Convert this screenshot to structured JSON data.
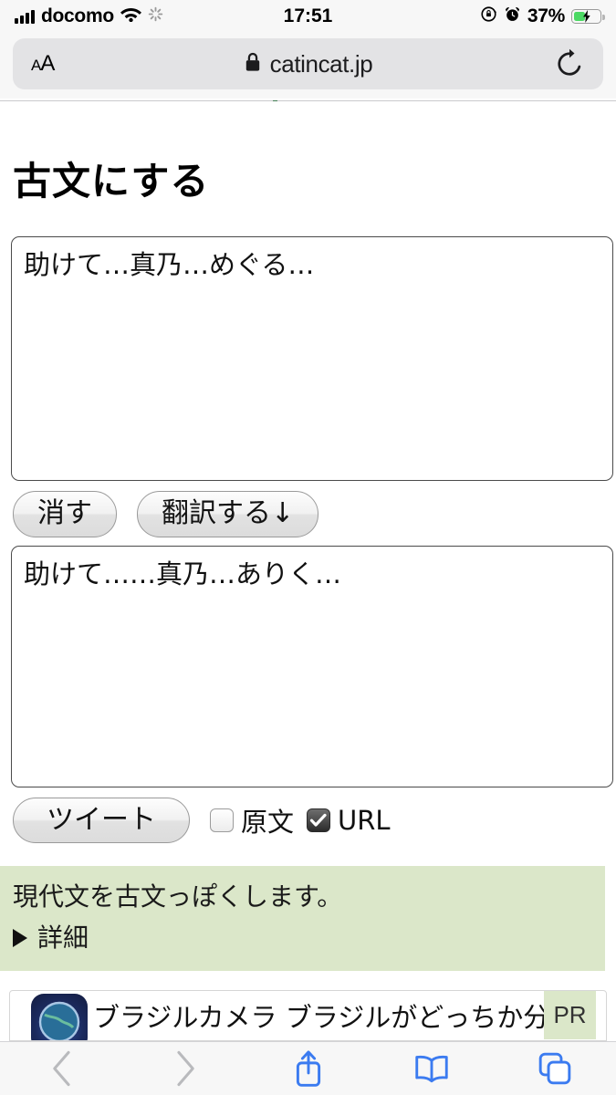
{
  "status_bar": {
    "carrier": "docomo",
    "time": "17:51",
    "battery_percent": "37%",
    "battery_level": 37,
    "icons": [
      "signal-bars-icon",
      "wifi-icon",
      "sync-spinner-icon",
      "rotation-lock-icon",
      "alarm-clock-icon",
      "battery-charging-icon"
    ]
  },
  "browser": {
    "text_size_label": "AA",
    "url": "catincat.jp",
    "lock_icon": "lock-icon",
    "reload_icon": "reload-icon",
    "toolbar": {
      "back_icon": "chevron-left-icon",
      "forward_icon": "chevron-right-icon",
      "share_icon": "share-icon",
      "bookmarks_icon": "book-icon",
      "tabs_icon": "tabs-icon"
    }
  },
  "page": {
    "title": "古文にする",
    "input_text": "助けて…真乃…めぐる…",
    "output_text": "助けて……真乃…ありく…",
    "clear_button": "消す",
    "translate_button": "翻訳する↓",
    "tweet_button": "ツイート",
    "checkboxes": [
      {
        "label": "原文",
        "checked": false
      },
      {
        "label": "URL",
        "checked": true
      }
    ],
    "note": {
      "description": "現代文を古文っぽくします。",
      "details_label": "詳細",
      "background_color": "#dbe7c9"
    }
  },
  "ad": {
    "text": "ブラジルカメラ ブラジルがどっちか分",
    "badge": "PR",
    "icon": "globe-app-icon"
  }
}
